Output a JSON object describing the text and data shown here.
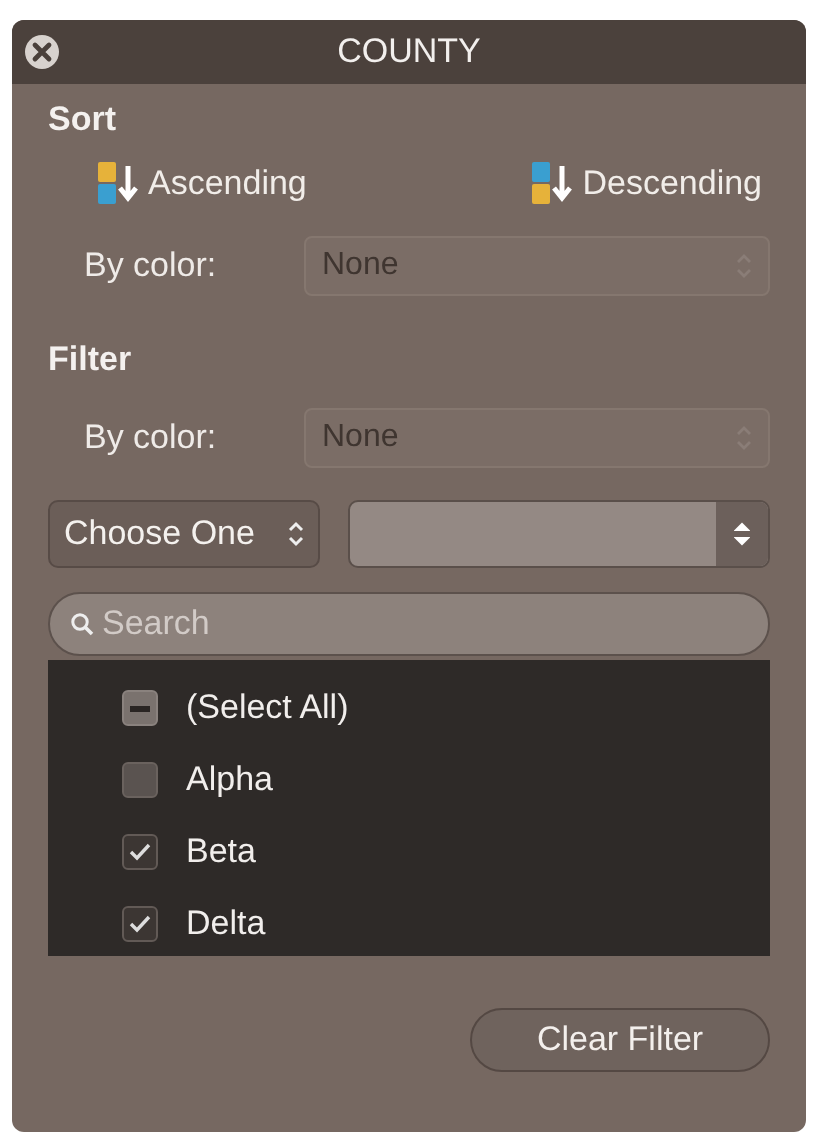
{
  "window": {
    "title": "COUNTY"
  },
  "sort": {
    "heading": "Sort",
    "ascending": "Ascending",
    "descending": "Descending",
    "by_color_label": "By color:",
    "by_color_value": "None"
  },
  "filter": {
    "heading": "Filter",
    "by_color_label": "By color:",
    "by_color_value": "None",
    "condition": "Choose One",
    "search": {
      "placeholder": "Search"
    },
    "select_all": {
      "label": "(Select All)",
      "mixed": true
    },
    "items": [
      {
        "label": "Alpha",
        "checked": false
      },
      {
        "label": "Beta",
        "checked": true
      },
      {
        "label": "Delta",
        "checked": true
      }
    ]
  },
  "clear_button": "Clear Filter"
}
